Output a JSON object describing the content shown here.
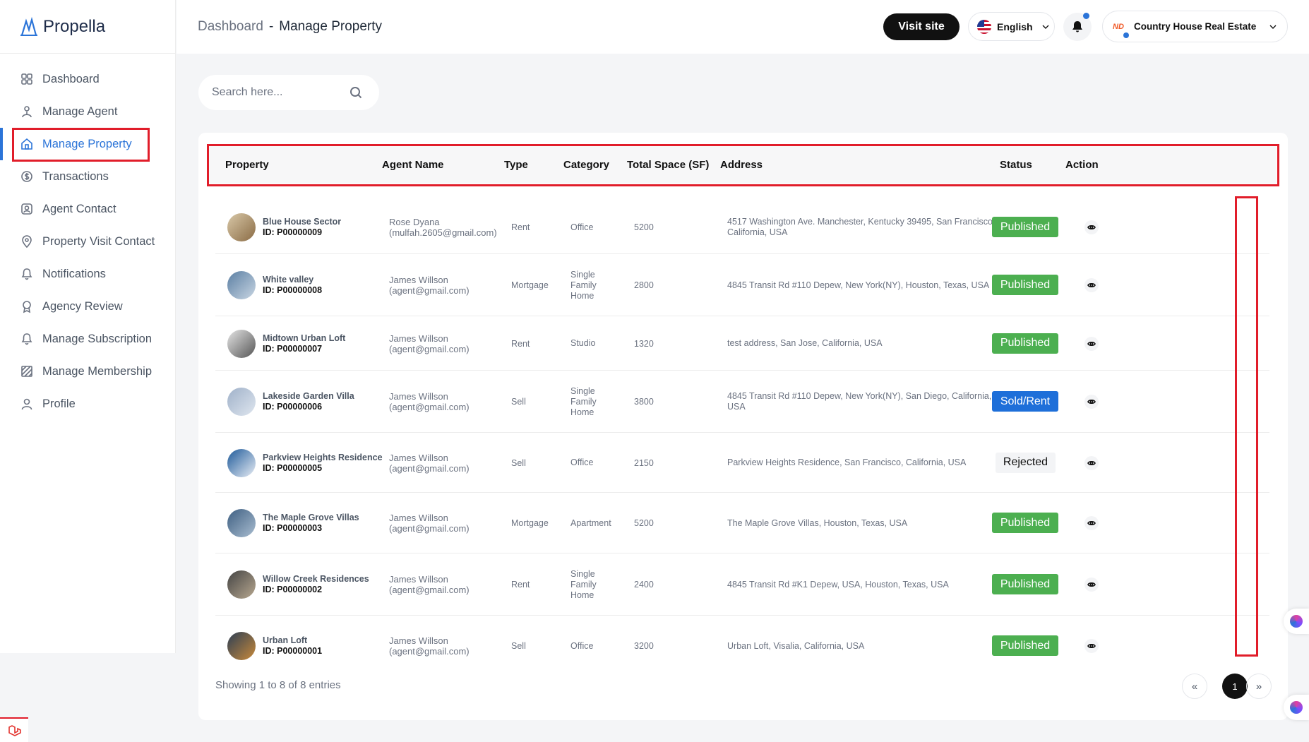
{
  "brand": {
    "name": "Propella"
  },
  "sidebar": {
    "items": [
      {
        "label": "Dashboard",
        "icon": "grid-icon",
        "active": false
      },
      {
        "label": "Manage Agent",
        "icon": "agent-icon",
        "active": false
      },
      {
        "label": "Manage Property",
        "icon": "home-icon",
        "active": true
      },
      {
        "label": "Transactions",
        "icon": "dollar-icon",
        "active": false
      },
      {
        "label": "Agent Contact",
        "icon": "contact-icon",
        "active": false
      },
      {
        "label": "Property Visit Contact",
        "icon": "map-pin-icon",
        "active": false
      },
      {
        "label": "Notifications",
        "icon": "bell-icon",
        "active": false
      },
      {
        "label": "Agency Review",
        "icon": "award-icon",
        "active": false
      },
      {
        "label": "Manage Subscription",
        "icon": "bell-icon",
        "active": false
      },
      {
        "label": "Manage Membership",
        "icon": "membership-icon",
        "active": false
      },
      {
        "label": "Profile",
        "icon": "user-icon",
        "active": false
      }
    ]
  },
  "header": {
    "breadcrumb": {
      "root": "Dashboard",
      "separator": "-",
      "current": "Manage Property"
    },
    "visit_site": "Visit site",
    "language": "English",
    "account_name": "Country House Real Estate",
    "account_logo_text": "ND"
  },
  "search": {
    "placeholder": "Search here..."
  },
  "table": {
    "columns": [
      "Property",
      "Agent Name",
      "Type",
      "Category",
      "Total Space (SF)",
      "Address",
      "Status",
      "Action"
    ],
    "rows": [
      {
        "name": "Blue House Sector",
        "id": "ID: P00000009",
        "agent": "Rose Dyana",
        "agent_email": "(mulfah.2605@gmail.com)",
        "type": "Rent",
        "category": [
          "Office"
        ],
        "space": "5200",
        "address": [
          "4517 Washington Ave. Manchester, Kentucky 39495, San Francisco,",
          "California, USA"
        ],
        "status": "Published"
      },
      {
        "name": "White valley",
        "id": "ID: P00000008",
        "agent": "James Willson",
        "agent_email": "(agent@gmail.com)",
        "type": "Mortgage",
        "category": [
          "Single",
          "Family",
          "Home"
        ],
        "space": "2800",
        "address": [
          "4845 Transit Rd #110 Depew, New York(NY), Houston, Texas, USA"
        ],
        "status": "Published"
      },
      {
        "name": "Midtown Urban Loft",
        "id": "ID: P00000007",
        "agent": "James Willson",
        "agent_email": "(agent@gmail.com)",
        "type": "Rent",
        "category": [
          "Studio"
        ],
        "space": "1320",
        "address": [
          "test address, San Jose, California, USA"
        ],
        "status": "Published"
      },
      {
        "name": "Lakeside Garden Villa",
        "id": "ID: P00000006",
        "agent": "James Willson",
        "agent_email": "(agent@gmail.com)",
        "type": "Sell",
        "category": [
          "Single",
          "Family",
          "Home"
        ],
        "space": "3800",
        "address": [
          "4845 Transit Rd #110 Depew, New York(NY), San Diego, California,",
          "USA"
        ],
        "status": "Sold/Rent"
      },
      {
        "name": "Parkview Heights Residence",
        "id": "ID: P00000005",
        "agent": "James Willson",
        "agent_email": "(agent@gmail.com)",
        "type": "Sell",
        "category": [
          "Office"
        ],
        "space": "2150",
        "address": [
          "Parkview Heights Residence, San Francisco, California, USA"
        ],
        "status": "Rejected"
      },
      {
        "name": "The Maple Grove Villas",
        "id": "ID: P00000003",
        "agent": "James Willson",
        "agent_email": "(agent@gmail.com)",
        "type": "Mortgage",
        "category": [
          "Apartment"
        ],
        "space": "5200",
        "address": [
          "The Maple Grove Villas, Houston, Texas, USA"
        ],
        "status": "Published"
      },
      {
        "name": "Willow Creek Residences",
        "id": "ID: P00000002",
        "agent": "James Willson",
        "agent_email": "(agent@gmail.com)",
        "type": "Rent",
        "category": [
          "Single",
          "Family",
          "Home"
        ],
        "space": "2400",
        "address": [
          "4845 Transit Rd #K1 Depew, USA, Houston, Texas, USA"
        ],
        "status": "Published"
      },
      {
        "name": "Urban Loft",
        "id": "ID: P00000001",
        "agent": "James Willson",
        "agent_email": "(agent@gmail.com)",
        "type": "Sell",
        "category": [
          "Office"
        ],
        "space": "3200",
        "address": [
          "Urban Loft, Visalia, California, USA"
        ],
        "status": "Published"
      }
    ]
  },
  "footer": {
    "entries_text": "Showing 1 to 8 of 8 entries",
    "pagination": {
      "prev": "«",
      "current": "1",
      "next": "»"
    }
  },
  "colors": {
    "accent": "#2b74d8",
    "published": "#4caf50",
    "sold": "#1e6fd9",
    "highlight": "#e11d2a"
  }
}
